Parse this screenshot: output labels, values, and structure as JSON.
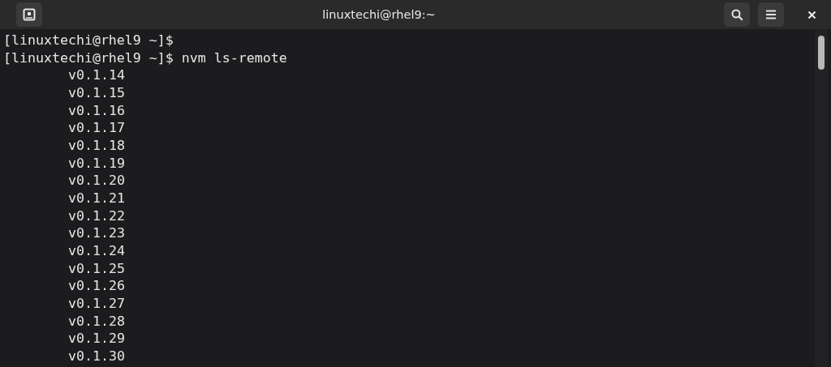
{
  "window": {
    "title": "linuxtechi@rhel9:~"
  },
  "terminal": {
    "lines": [
      {
        "kind": "prompt",
        "text": "[linuxtechi@rhel9 ~]$"
      },
      {
        "kind": "prompt",
        "text": "[linuxtechi@rhel9 ~]$ nvm ls-remote"
      },
      {
        "kind": "output",
        "text": "v0.1.14"
      },
      {
        "kind": "output",
        "text": "v0.1.15"
      },
      {
        "kind": "output",
        "text": "v0.1.16"
      },
      {
        "kind": "output",
        "text": "v0.1.17"
      },
      {
        "kind": "output",
        "text": "v0.1.18"
      },
      {
        "kind": "output",
        "text": "v0.1.19"
      },
      {
        "kind": "output",
        "text": "v0.1.20"
      },
      {
        "kind": "output",
        "text": "v0.1.21"
      },
      {
        "kind": "output",
        "text": "v0.1.22"
      },
      {
        "kind": "output",
        "text": "v0.1.23"
      },
      {
        "kind": "output",
        "text": "v0.1.24"
      },
      {
        "kind": "output",
        "text": "v0.1.25"
      },
      {
        "kind": "output",
        "text": "v0.1.26"
      },
      {
        "kind": "output",
        "text": "v0.1.27"
      },
      {
        "kind": "output",
        "text": "v0.1.28"
      },
      {
        "kind": "output",
        "text": "v0.1.29"
      },
      {
        "kind": "output",
        "text": "v0.1.30"
      }
    ]
  }
}
